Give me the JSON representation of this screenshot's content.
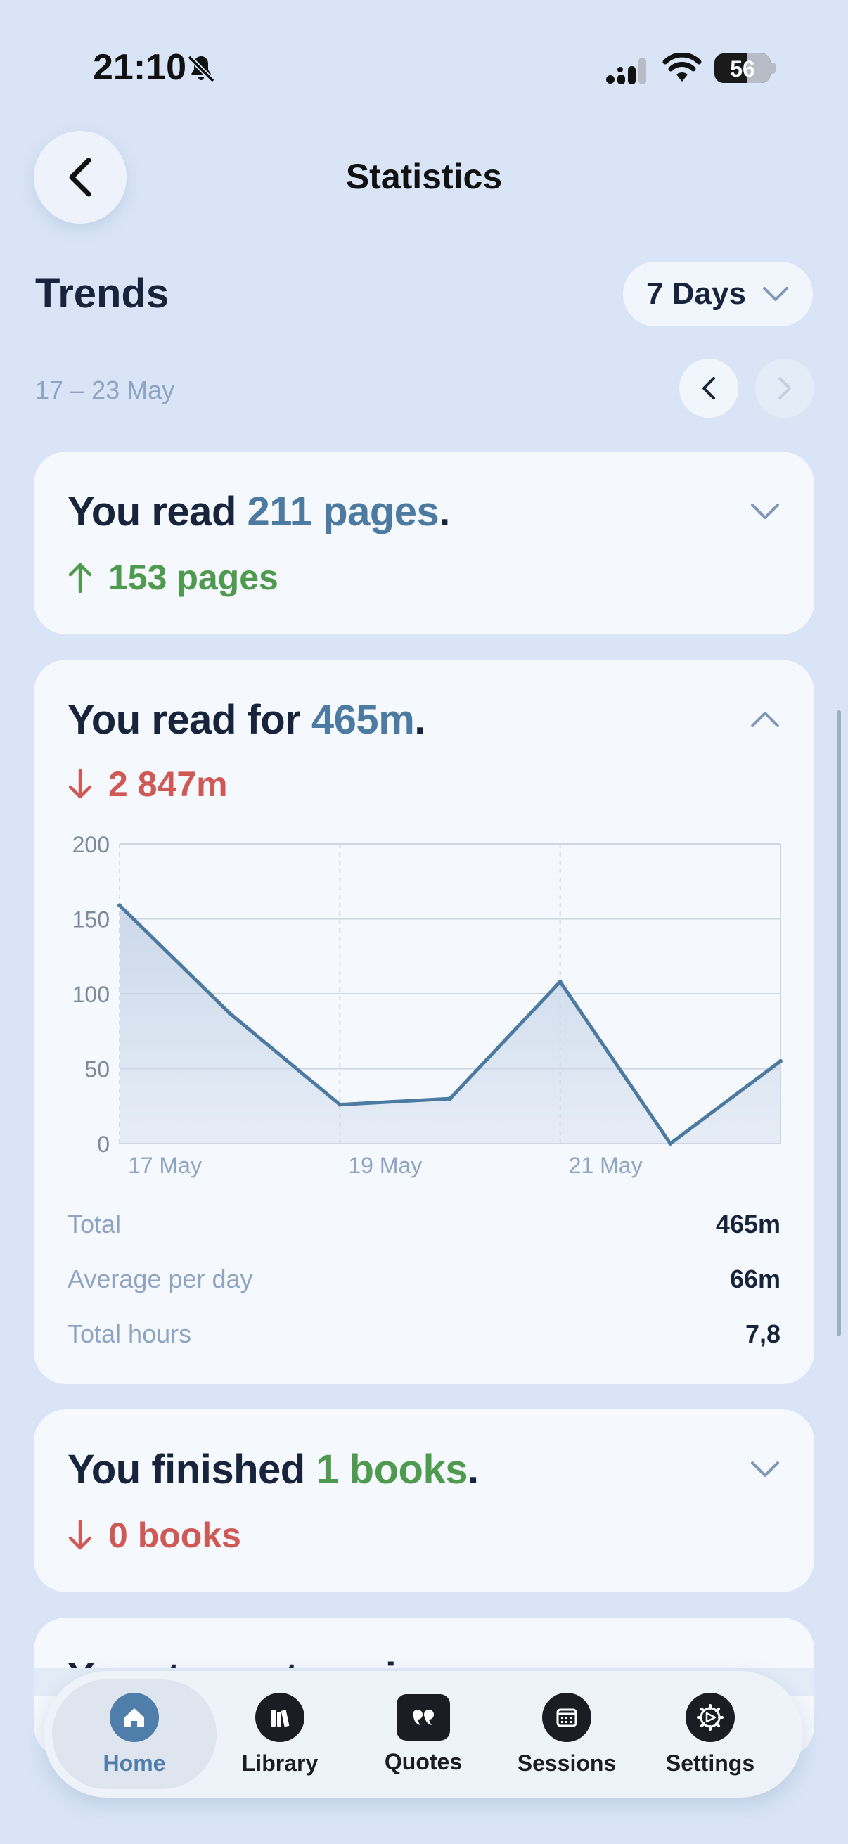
{
  "status_bar": {
    "time": "21:10",
    "battery": "56"
  },
  "header": {
    "title": "Statistics"
  },
  "trends": {
    "heading": "Trends",
    "range_label": "7 Days",
    "date_range": "17 – 23 May"
  },
  "cards": {
    "pages": {
      "prefix": "You read ",
      "value": "211 pages",
      "suffix": ".",
      "delta": "153 pages",
      "delta_direction": "up"
    },
    "time": {
      "prefix": "You read for ",
      "value": "465m",
      "suffix": ".",
      "delta": "2 847m",
      "delta_direction": "down"
    },
    "books": {
      "prefix": "You finished ",
      "value": "1 books",
      "suffix": ".",
      "delta": "0 books",
      "delta_direction": "down"
    },
    "categories": {
      "heading": "Your top categories were"
    }
  },
  "chart_data": {
    "type": "area",
    "x": [
      "17 May",
      "18 May",
      "19 May",
      "20 May",
      "21 May",
      "22 May",
      "23 May"
    ],
    "x_tick_labels": [
      "17 May",
      "19 May",
      "21 May"
    ],
    "values": [
      159,
      87,
      26,
      30,
      108,
      0,
      55
    ],
    "y_ticks": [
      "200",
      "150",
      "100",
      "50",
      "0"
    ],
    "ylim": [
      0,
      200
    ],
    "grid": true,
    "colors": {
      "line": "#4d7aa1",
      "fill": "#c9d7e9"
    }
  },
  "stats": [
    {
      "label": "Total",
      "value": "465m"
    },
    {
      "label": "Average per day",
      "value": "66m"
    },
    {
      "label": "Total hours",
      "value": "7,8"
    }
  ],
  "tabs": [
    {
      "label": "Home",
      "icon": "home-icon",
      "active": true
    },
    {
      "label": "Library",
      "icon": "books-icon",
      "active": false
    },
    {
      "label": "Quotes",
      "icon": "quote-icon",
      "active": false
    },
    {
      "label": "Sessions",
      "icon": "calendar-icon",
      "active": false
    },
    {
      "label": "Settings",
      "icon": "gear-icon",
      "active": false
    }
  ],
  "colors": {
    "accent": "#4d7aa1",
    "positive": "#4f9a4f",
    "negative": "#cf5a55",
    "background": "#d9e5f6"
  }
}
